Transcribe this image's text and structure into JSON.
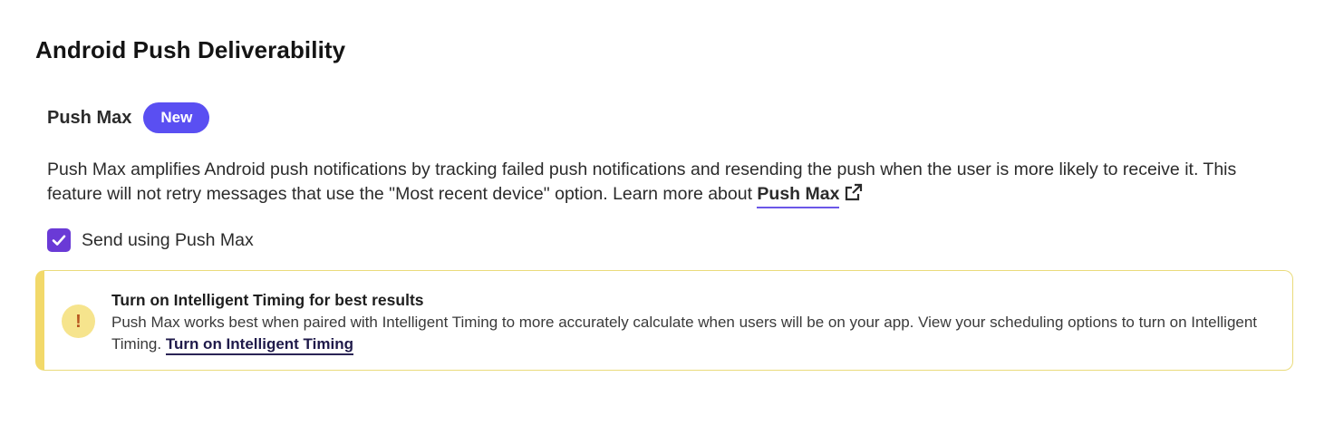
{
  "section": {
    "title": "Android Push Deliverability"
  },
  "feature": {
    "name": "Push Max",
    "badge": "New",
    "badge_color": "#5a4ff2"
  },
  "description": {
    "text": "Push Max amplifies Android push notifications by tracking failed push notifications and resending the push when the user is more likely to receive it. This feature will not retry messages that use the \"Most recent device\" option. Learn more about ",
    "link_label": "Push Max",
    "link_icon": "external-link-icon"
  },
  "checkbox": {
    "label": "Send using Push Max",
    "checked": true,
    "color": "#6a3ad6"
  },
  "alert": {
    "icon": "exclamation-icon",
    "title": "Turn on Intelligent Timing for best results",
    "body": "Push Max works best when paired with Intelligent Timing to more accurately calculate when users will be on your app. View your scheduling options to turn on Intelligent Timing. ",
    "link_label": "Turn on Intelligent Timing",
    "accent_color": "#f2d96a"
  }
}
